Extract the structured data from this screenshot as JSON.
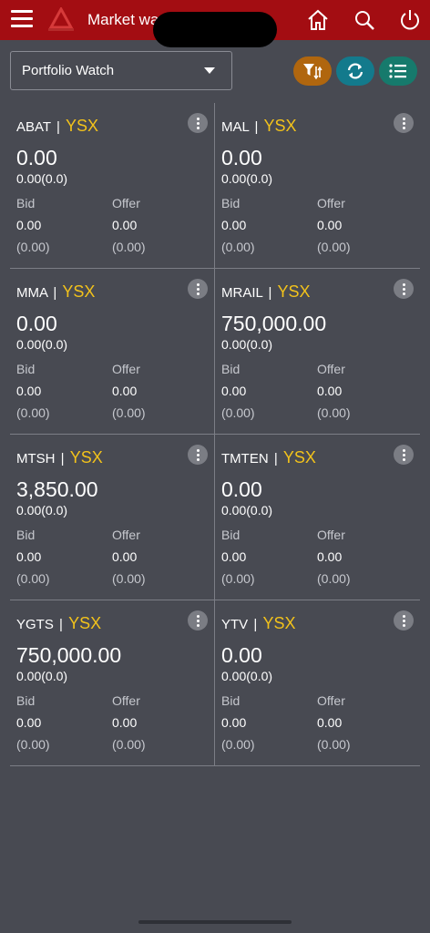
{
  "header": {
    "title": "Market wa"
  },
  "toolbar": {
    "watchlist_selected": "Portfolio Watch"
  },
  "colors": {
    "header_bg": "#a30d12",
    "exchange_text": "#f2c21b",
    "filter_button": "#b0660e",
    "refresh_button": "#137a8c",
    "list_button": "#167a6c"
  },
  "stocks": [
    {
      "symbol": "ABAT",
      "sep": "|",
      "exchange": "YSX",
      "price": "0.00",
      "change": "0.00(0.0)",
      "bid_label": "Bid",
      "offer_label": "Offer",
      "bid": "0.00",
      "offer": "0.00",
      "bid_pct": "(0.00)",
      "offer_pct": "(0.00)"
    },
    {
      "symbol": "MAL",
      "sep": "|",
      "exchange": "YSX",
      "price": "0.00",
      "change": "0.00(0.0)",
      "bid_label": "Bid",
      "offer_label": "Offer",
      "bid": "0.00",
      "offer": "0.00",
      "bid_pct": "(0.00)",
      "offer_pct": "(0.00)"
    },
    {
      "symbol": "MMA",
      "sep": "|",
      "exchange": "YSX",
      "price": "0.00",
      "change": "0.00(0.0)",
      "bid_label": "Bid",
      "offer_label": "Offer",
      "bid": "0.00",
      "offer": "0.00",
      "bid_pct": "(0.00)",
      "offer_pct": "(0.00)"
    },
    {
      "symbol": "MRAIL",
      "sep": "|",
      "exchange": "YSX",
      "price": "750,000.00",
      "change": "0.00(0.0)",
      "bid_label": "Bid",
      "offer_label": "Offer",
      "bid": "0.00",
      "offer": "0.00",
      "bid_pct": "(0.00)",
      "offer_pct": "(0.00)"
    },
    {
      "symbol": "MTSH",
      "sep": "|",
      "exchange": "YSX",
      "price": "3,850.00",
      "change": "0.00(0.0)",
      "bid_label": "Bid",
      "offer_label": "Offer",
      "bid": "0.00",
      "offer": "0.00",
      "bid_pct": "(0.00)",
      "offer_pct": "(0.00)"
    },
    {
      "symbol": "TMTEN",
      "sep": "|",
      "exchange": "YSX",
      "price": "0.00",
      "change": "0.00(0.0)",
      "bid_label": "Bid",
      "offer_label": "Offer",
      "bid": "0.00",
      "offer": "0.00",
      "bid_pct": "(0.00)",
      "offer_pct": "(0.00)"
    },
    {
      "symbol": "YGTS",
      "sep": "|",
      "exchange": "YSX",
      "price": "750,000.00",
      "change": "0.00(0.0)",
      "bid_label": "Bid",
      "offer_label": "Offer",
      "bid": "0.00",
      "offer": "0.00",
      "bid_pct": "(0.00)",
      "offer_pct": "(0.00)"
    },
    {
      "symbol": "YTV",
      "sep": "|",
      "exchange": "YSX",
      "price": "0.00",
      "change": "0.00(0.0)",
      "bid_label": "Bid",
      "offer_label": "Offer",
      "bid": "0.00",
      "offer": "0.00",
      "bid_pct": "(0.00)",
      "offer_pct": "(0.00)"
    }
  ]
}
